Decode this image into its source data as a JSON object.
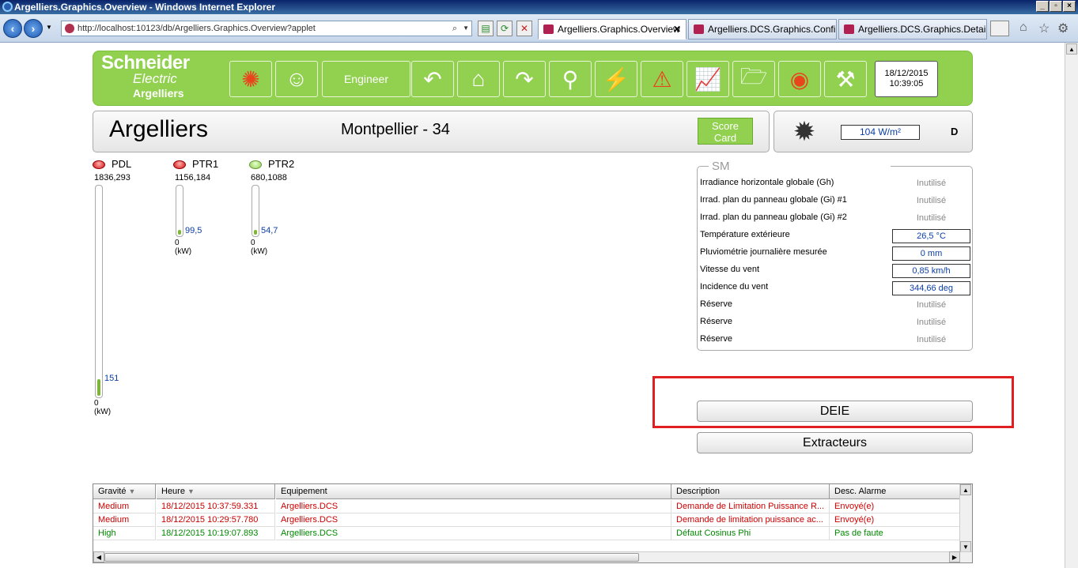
{
  "window": {
    "title": "Argelliers.Graphics.Overview - Windows Internet Explorer"
  },
  "browser": {
    "address": "http://localhost:10123/db/Argelliers.Graphics.Overview?applet",
    "tabs": [
      {
        "label": "Argelliers.Graphics.Overview",
        "close": "✕"
      },
      {
        "label": "Argelliers.DCS.Graphics.Confi..."
      },
      {
        "label": "Argelliers.DCS.Graphics.Detail"
      }
    ]
  },
  "header": {
    "logo_line1": "Schneider",
    "logo_line2": "Electric",
    "logo_site": "Argelliers",
    "engineer_label": "Engineer",
    "date": "18/12/2015",
    "time": "10:39:05"
  },
  "site": {
    "name": "Argelliers",
    "location": "Montpellier - 34",
    "scorecard_line1": "Score",
    "scorecard_line2": "Card"
  },
  "weather": {
    "irradiance": "104 W/m²",
    "label": "D"
  },
  "meters": [
    {
      "name": "PDL",
      "status": "red",
      "max": "1836,293",
      "value": "151",
      "fill": 0.08,
      "unit": "0 (kW)"
    },
    {
      "name": "PTR1",
      "status": "red",
      "max": "1156,184",
      "value": "99,5",
      "fill": 0.09,
      "unit": "0 (kW)"
    },
    {
      "name": "PTR2",
      "status": "green",
      "max": "680,1088",
      "value": "54,7",
      "fill": 0.08,
      "unit": "0 (kW)"
    }
  ],
  "sm": {
    "legend": "SM",
    "rows": [
      {
        "label": "Irradiance horizontale globale (Gh)",
        "value": "Inutilisé",
        "boxed": false
      },
      {
        "label": "Irrad. plan du panneau globale (Gi) #1",
        "value": "Inutilisé",
        "boxed": false
      },
      {
        "label": "Irrad. plan du panneau globale (Gi) #2",
        "value": "Inutilisé",
        "boxed": false
      },
      {
        "label": "Température extérieure",
        "value": "26,5 °C",
        "boxed": true
      },
      {
        "label": "Pluviométrie journalière mesurée",
        "value": "0 mm",
        "boxed": true
      },
      {
        "label": "Vitesse du vent",
        "value": "0,85 km/h",
        "boxed": true
      },
      {
        "label": "Incidence du vent",
        "value": "344,66 deg",
        "boxed": true
      },
      {
        "label": "Réserve",
        "value": "Inutilisé",
        "boxed": false
      },
      {
        "label": "Réserve",
        "value": "Inutilisé",
        "boxed": false
      },
      {
        "label": "Réserve",
        "value": "Inutilisé",
        "boxed": false
      }
    ]
  },
  "buttons": {
    "deie": "DEIE",
    "extracteurs": "Extracteurs"
  },
  "alarm_table": {
    "columns": [
      "Gravité",
      "Heure",
      "Equipement",
      "Description",
      "Desc. Alarme"
    ],
    "rows": [
      {
        "gravite": "Medium",
        "heure": "18/12/2015 10:37:59.331",
        "equipement": "Argelliers.DCS",
        "description": "Demande de Limitation Puissance R...",
        "desc_alarme": "Envoyé(e)",
        "color": "#cc0000"
      },
      {
        "gravite": "Medium",
        "heure": "18/12/2015 10:29:57.780",
        "equipement": "Argelliers.DCS",
        "description": "Demande de limitation puissance ac...",
        "desc_alarme": "Envoyé(e)",
        "color": "#cc0000"
      },
      {
        "gravite": "High",
        "heure": "18/12/2015 10:19:07.893",
        "equipement": "Argelliers.DCS",
        "description": "Défaut Cosinus Phi",
        "desc_alarme": "Pas de faute",
        "color": "#008800"
      }
    ]
  },
  "colors": {
    "brand_green": "#92d050",
    "alarm_red": "#cc0000",
    "alarm_green": "#008800",
    "value_blue": "#0b3ea8"
  }
}
